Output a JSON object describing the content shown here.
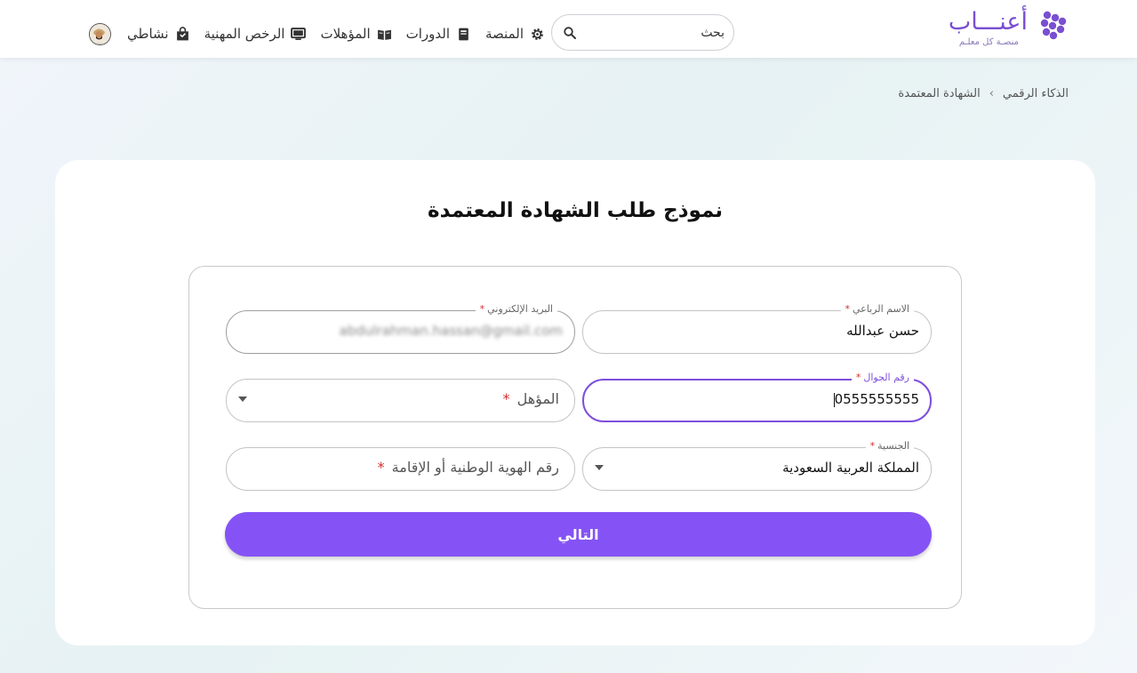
{
  "brand": {
    "name": "أعنـــاب",
    "tagline": "منصـة كل معلـم",
    "accent": "#8553f5"
  },
  "search": {
    "placeholder": "بحث"
  },
  "nav": {
    "items": [
      {
        "label": "المنصة",
        "icon": "gear-icon"
      },
      {
        "label": "الدورات",
        "icon": "book-icon"
      },
      {
        "label": "المؤهلات",
        "icon": "open-book-icon"
      },
      {
        "label": "الرخص المهنية",
        "icon": "monitor-icon"
      },
      {
        "label": "نشاطي",
        "icon": "bag-icon"
      }
    ],
    "avatar_icon": "user-avatar-icon"
  },
  "breadcrumb": {
    "items": [
      "الذكاء الرقمي",
      "الشهادة المعتمدة"
    ],
    "separator": "›"
  },
  "form": {
    "title": "نموذج طلب الشهادة المعتمدة",
    "fields": {
      "full_name": {
        "label": "الاسم الرباعي",
        "value": "حسن عبدالله"
      },
      "email": {
        "label": "البريد الإلكتروني",
        "value": "abdulrahman.hassan@gmail.com"
      },
      "mobile": {
        "label": "رقم الجوال",
        "value": "0555555555"
      },
      "qualification": {
        "placeholder": "المؤهل"
      },
      "nationality": {
        "label": "الجنسية",
        "value": "المملكة العربية السعودية"
      },
      "national_id": {
        "placeholder": "رقم الهوية الوطنية أو الإقامة"
      }
    },
    "required_mark": "*",
    "next_label": "التالي"
  }
}
